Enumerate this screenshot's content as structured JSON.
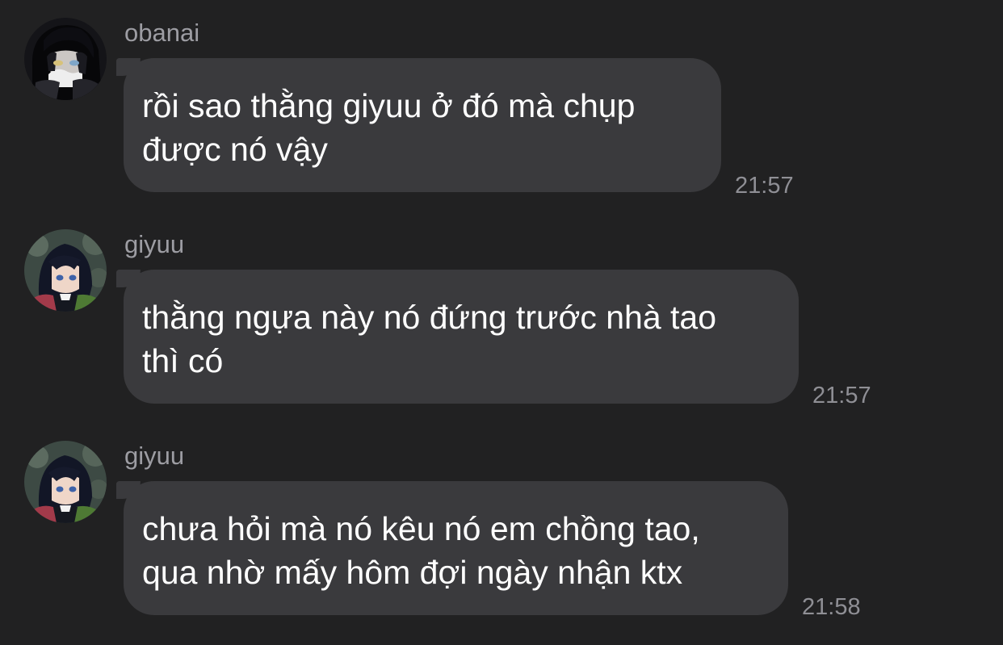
{
  "messages": [
    {
      "sender": "obanai",
      "avatar": "obanai-avatar",
      "text": "rồi sao thằng giyuu ở đó mà chụp\nđược nó vậy",
      "time": "21:57"
    },
    {
      "sender": "giyuu",
      "avatar": "giyuu-avatar",
      "text": "thằng ngựa này nó đứng trước nhà tao\nthì có",
      "time": "21:57"
    },
    {
      "sender": "giyuu",
      "avatar": "giyuu-avatar",
      "text": "chưa hỏi mà nó kêu nó em chồng tao,\nqua nhờ mấy hôm đợi ngày nhận ktx",
      "time": "21:58"
    }
  ],
  "colors": {
    "background": "#212122",
    "bubble": "#3a3a3d",
    "sender_text": "#9d9da3",
    "message_text": "#ffffff",
    "timestamp_text": "#8f8f95"
  }
}
